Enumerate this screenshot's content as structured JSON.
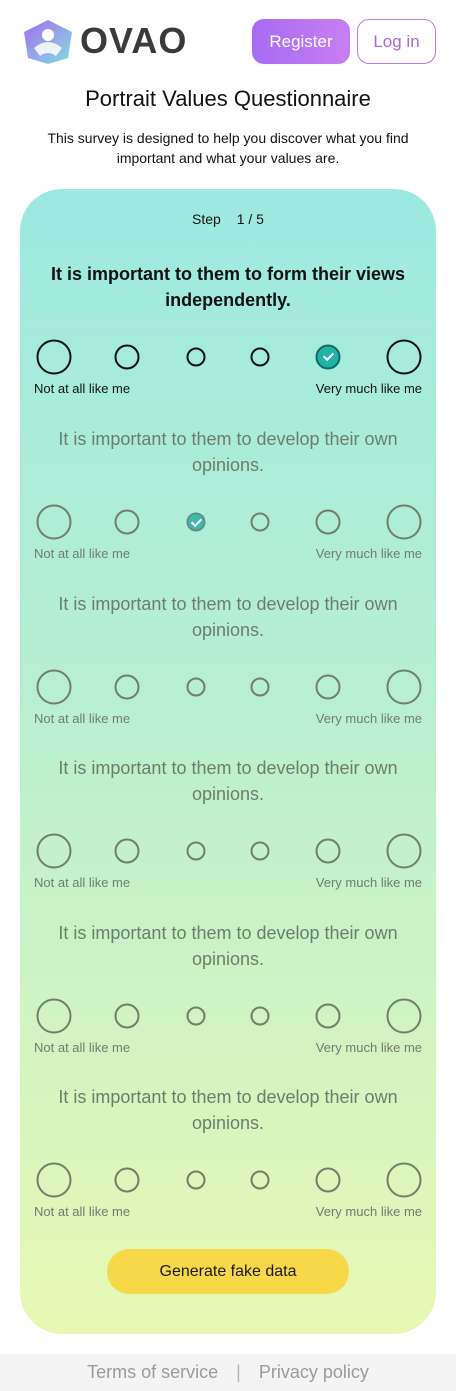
{
  "header": {
    "logo_icon": "ovao-logo-icon",
    "logo_text": "OVAO",
    "register_label": "Register",
    "login_label": "Log in"
  },
  "page": {
    "title": "Portrait Values Questionnaire",
    "intro": "This survey is designed to help you discover what you find important and what your values are."
  },
  "step": {
    "label": "Step",
    "value": "1 / 5"
  },
  "scale_labels": {
    "left": "Not at all like me",
    "right": "Very much like me"
  },
  "questions": [
    {
      "text": "It is important to them to form their views independently.",
      "selected": 5
    },
    {
      "text": "It is important to them to develop their own opinions.",
      "selected": 3
    },
    {
      "text": "It is important to them to develop their own opinions.",
      "selected": 0
    },
    {
      "text": "It is important to them to develop their own opinions.",
      "selected": 0
    },
    {
      "text": "It is important to them to develop their own opinions.",
      "selected": 0
    },
    {
      "text": "It is important to them to develop their own opinions.",
      "selected": 0
    }
  ],
  "generate_label": "Generate fake data",
  "footer": {
    "terms_label": "Terms of service",
    "separator": "|",
    "privacy_label": "Privacy policy"
  },
  "colors": {
    "accent": "#a66bf2",
    "checked": "#22b2a6",
    "generate": "#f7d848"
  }
}
